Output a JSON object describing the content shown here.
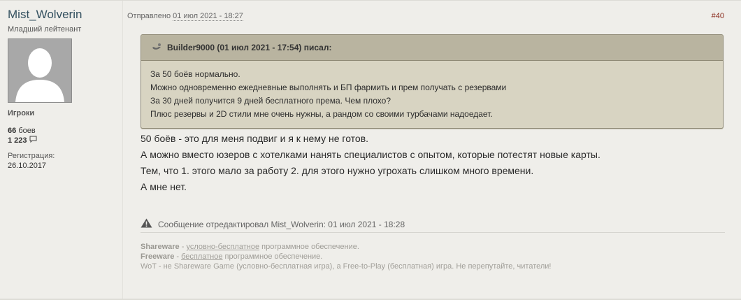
{
  "author": {
    "username": "Mist_Wolverin",
    "rank": "Младший лейтенант",
    "group": "Игроки",
    "battles_count": "66",
    "battles_label": "боев",
    "posts_count": "1 223",
    "registration_label": "Регистрация:",
    "registration_date": "26.10.2017"
  },
  "post": {
    "posted_label": "Отправлено",
    "posted_date": "01 июл 2021 - 18:27",
    "number": "#40"
  },
  "quote": {
    "header": "Builder9000 (01 июл 2021 - 17:54) писал:",
    "lines": [
      "За 50 боёв нормально.",
      "Можно одновременно ежедневные выполнять и БП фармить и прем получать с резервами",
      "За 30 дней получится 9 дней бесплатного према. Чем плохо?",
      "Плюс резервы и 2D стили мне очень нужны, а рандом со своими турбачами надоедает."
    ]
  },
  "message": {
    "lines": [
      "50 боёв - это для меня подвиг и я к нему не готов.",
      "А можно вместо юзеров с хотелками нанять специалистов с опытом, которые потестят новые карты.",
      "Тем, что 1. этого мало за работу 2. для этого нужно угрохать слишком много времени.",
      "А мне нет."
    ]
  },
  "edit_note": "Сообщение отредактировал Mist_Wolverin: 01 июл 2021 - 18:28",
  "signature": {
    "line1_term": "Shareware",
    "line1_sep": " - ",
    "line1_link": "условно-бесплатное",
    "line1_rest": " программное обеспечение.",
    "line2_term": "Freeware",
    "line2_sep": " - ",
    "line2_link": "бесплатное",
    "line2_rest": " программное обеспечение.",
    "line3": "WoT - не Shareware Game (условно-бесплатная игра), а Free-to-Play (бесплатная) игра. Не перепутайте, читатели!"
  }
}
